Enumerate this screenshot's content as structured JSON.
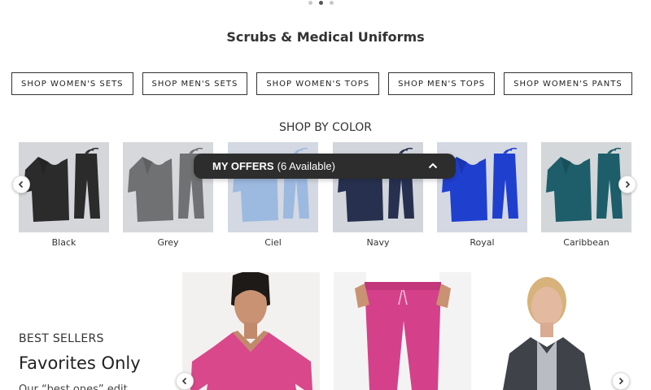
{
  "carousel": {
    "pages": 3,
    "active_index": 1
  },
  "heading": "Scrubs & Medical Uniforms",
  "shop_buttons": [
    "SHOP WOMEN'S SETS",
    "SHOP MEN'S SETS",
    "SHOP WOMEN'S TOPS",
    "SHOP MEN'S TOPS",
    "SHOP WOMEN'S PANTS"
  ],
  "shop_by_color": {
    "title": "SHOP BY COLOR",
    "colors": [
      {
        "label": "Black",
        "fabric": "#2b2b2b",
        "bg": "#d4d6da"
      },
      {
        "label": "Grey",
        "fabric": "#6f7173",
        "bg": "#d6d8dc"
      },
      {
        "label": "Ciel",
        "fabric": "#9cb9e0",
        "bg": "#d3d8e2"
      },
      {
        "label": "Navy",
        "fabric": "#27314f",
        "bg": "#d2d5dc"
      },
      {
        "label": "Royal",
        "fabric": "#1f3fcf",
        "bg": "#d4d8e2"
      },
      {
        "label": "Caribbean",
        "fabric": "#1d5e6a",
        "bg": "#d3d7da"
      }
    ]
  },
  "offers_bar": {
    "title": "MY OFFERS",
    "count_text": "(6 Available)"
  },
  "best_sellers": {
    "label": "BEST SELLERS",
    "title": "Favorites Only",
    "description": "Our “best ones” edit"
  },
  "products": [
    {
      "name": "pink-scrub-top",
      "color": "#d9488a"
    },
    {
      "name": "pink-jogger-pants",
      "color": "#d4418a"
    },
    {
      "name": "charcoal-jacket",
      "color": "#3f4248"
    }
  ]
}
